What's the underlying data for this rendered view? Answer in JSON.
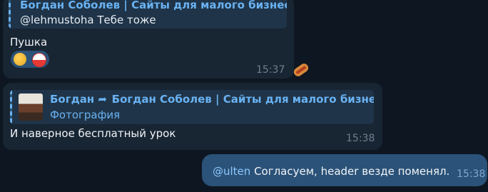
{
  "messages": [
    {
      "reply": {
        "author": "Богдан Соболев | Сайты для малого бизнеса",
        "text": "@lehmustoha Тебе тоже"
      },
      "text": "Пушка",
      "time": "15:37",
      "reactions": [
        "clapping-hands-emoji",
        "flag-emoji"
      ],
      "side_reaction": "hotdog-emoji"
    },
    {
      "reply": {
        "author": "Богдан",
        "forward_from": "Богдан Соболев | Сайты для малого бизнеса",
        "subtitle": "Фотография"
      },
      "text": "И наверное бесплатный урок",
      "time": "15:38"
    },
    {
      "mention": "@ulten",
      "text": " Согласуем, header везде поменял.",
      "time": "15:38"
    }
  ],
  "colors": {
    "background": "#0e1621",
    "incoming_bubble": "#182533",
    "outgoing_bubble": "#2b5278",
    "accent": "#6ab2f2"
  }
}
